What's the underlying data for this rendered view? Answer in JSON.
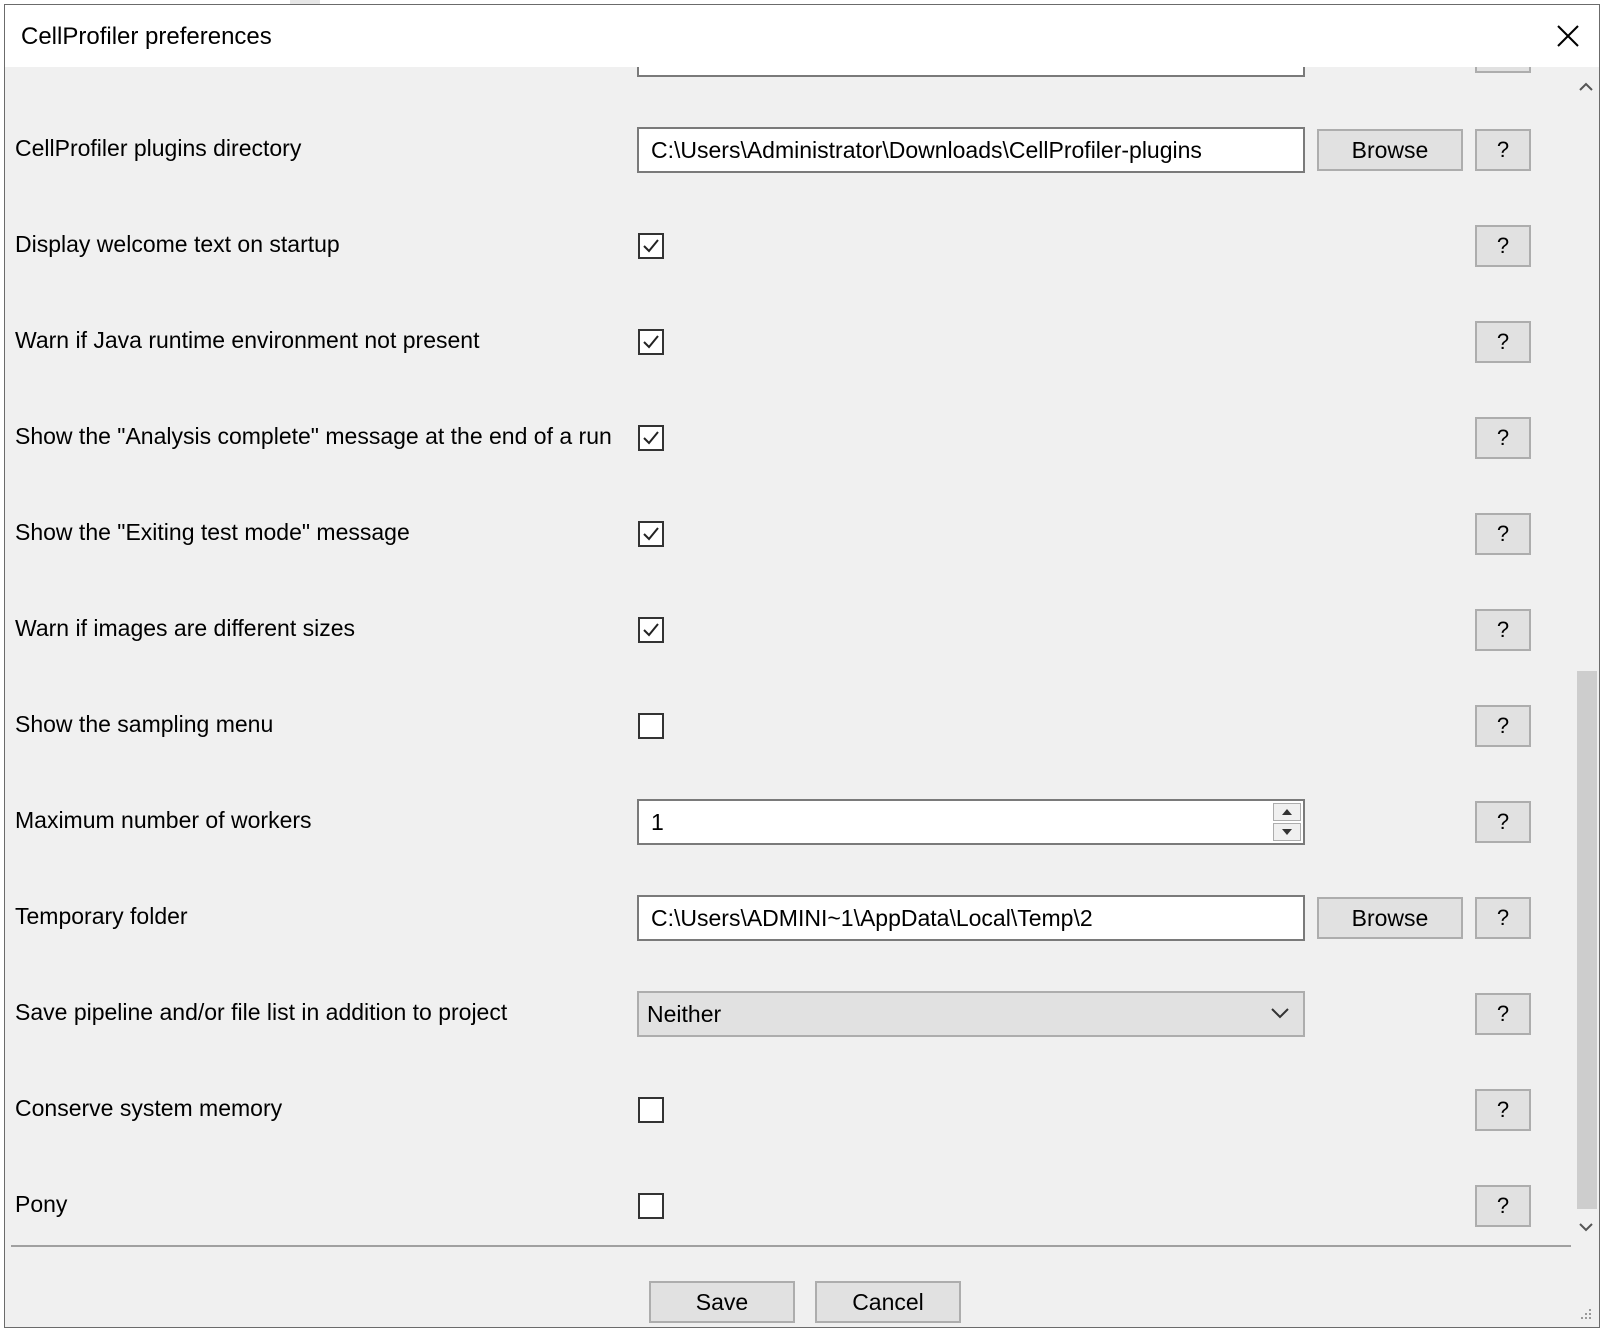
{
  "window": {
    "title": "CellProfiler preferences",
    "close_icon": "close-icon"
  },
  "settings": {
    "plugins_directory": {
      "label": "CellProfiler plugins directory",
      "value": "C:\\Users\\Administrator\\Downloads\\CellProfiler-plugins",
      "browse_label": "Browse",
      "help_label": "?"
    },
    "welcome_text": {
      "label": "Display welcome text on startup",
      "checked": true,
      "help_label": "?"
    },
    "warn_java": {
      "label": "Warn if Java runtime environment not present",
      "checked": true,
      "help_label": "?"
    },
    "analysis_complete": {
      "label": "Show the \"Analysis complete\" message at the end of a run",
      "checked": true,
      "help_label": "?"
    },
    "exiting_test_mode": {
      "label": "Show the \"Exiting test mode\" message",
      "checked": true,
      "help_label": "?"
    },
    "warn_image_sizes": {
      "label": "Warn if images are different sizes",
      "checked": true,
      "help_label": "?"
    },
    "sampling_menu": {
      "label": "Show the sampling menu",
      "checked": false,
      "help_label": "?"
    },
    "max_workers": {
      "label": "Maximum number of workers",
      "value": "1",
      "help_label": "?"
    },
    "temp_folder": {
      "label": "Temporary folder",
      "value": "C:\\Users\\ADMINI~1\\AppData\\Local\\Temp\\2",
      "browse_label": "Browse",
      "help_label": "?"
    },
    "save_pipeline": {
      "label": "Save pipeline and/or file list in addition to project",
      "selected": "Neither",
      "help_label": "?"
    },
    "conserve_memory": {
      "label": "Conserve system memory",
      "checked": false,
      "help_label": "?"
    },
    "pony": {
      "label": "Pony",
      "checked": false,
      "help_label": "?"
    }
  },
  "footer": {
    "save_label": "Save",
    "cancel_label": "Cancel"
  },
  "colors": {
    "window_bg": "#f0f0f0",
    "titlebar_bg": "#ffffff",
    "button_bg": "#e1e1e1",
    "scroll_thumb": "#cdcdcd"
  }
}
